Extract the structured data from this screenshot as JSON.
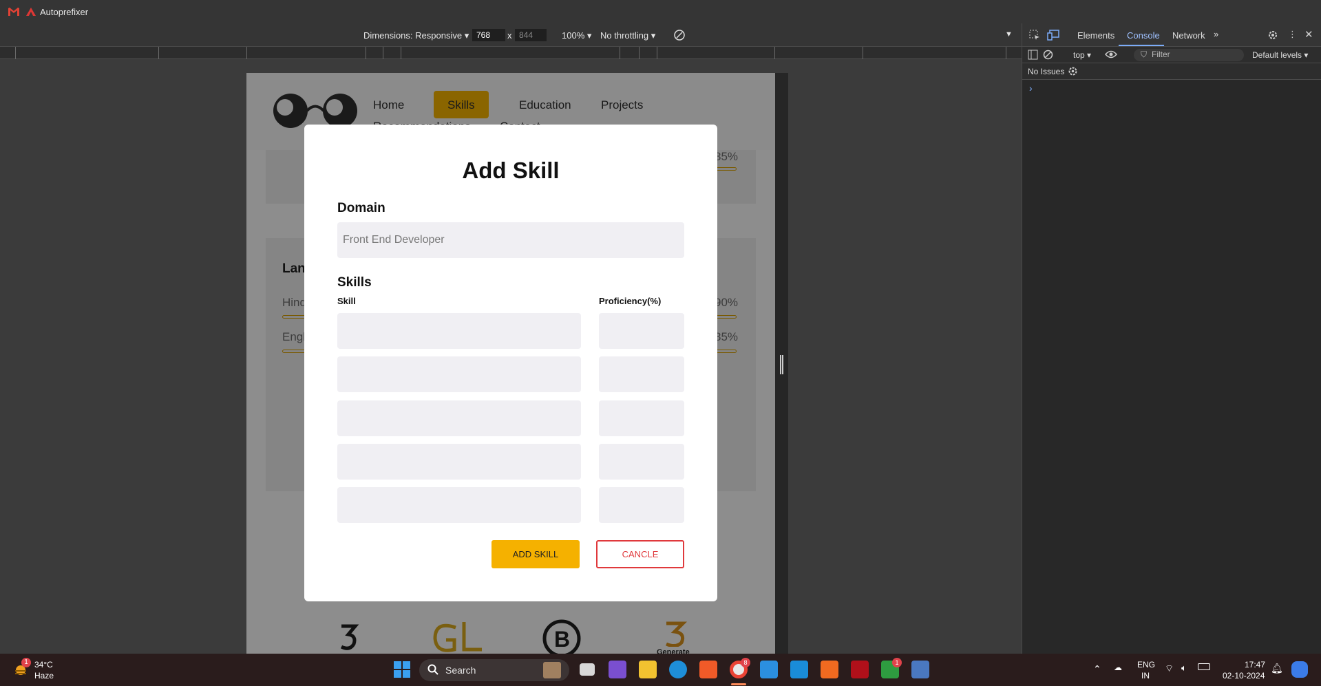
{
  "browser": {
    "bookmark_label": "Autoprefixer"
  },
  "device_toolbar": {
    "dimensions": "Dimensions: Responsive",
    "width": "768",
    "times": "x",
    "height": "844",
    "zoom": "100%",
    "throttle": "No throttling"
  },
  "page": {
    "nav": {
      "home": "Home",
      "skills": "Skills",
      "education": "Education",
      "projects": "Projects",
      "recommendations": "Recommendations",
      "contact": "Contact"
    },
    "bg": {
      "pct1": "85%",
      "lang_head": "Lan",
      "hind": "Hind",
      "pct2": "90%",
      "engl": "Engl",
      "pct3": "85%",
      "generate": "Generate"
    }
  },
  "modal": {
    "title": "Add Skill",
    "domain_label": "Domain",
    "domain_value": "Front End Developer",
    "skills_label": "Skills",
    "col_skill": "Skill",
    "col_proficiency": "Proficiency(%)",
    "add_button": "ADD SKILL",
    "cancel_button": "CANCLE"
  },
  "devtools": {
    "tabs": {
      "elements": "Elements",
      "console": "Console",
      "network": "Network"
    },
    "context": "top",
    "filter_placeholder": "Filter",
    "levels": "Default levels",
    "issues": "No Issues",
    "prompt": "›"
  },
  "taskbar": {
    "temp": "34°C",
    "weather": "Haze",
    "weather_badge": "1",
    "search": "Search",
    "chrome_badge": "8",
    "xbox_badge": "1",
    "lang": "ENG",
    "region": "IN",
    "time": "17:47",
    "date": "02-10-2024"
  }
}
